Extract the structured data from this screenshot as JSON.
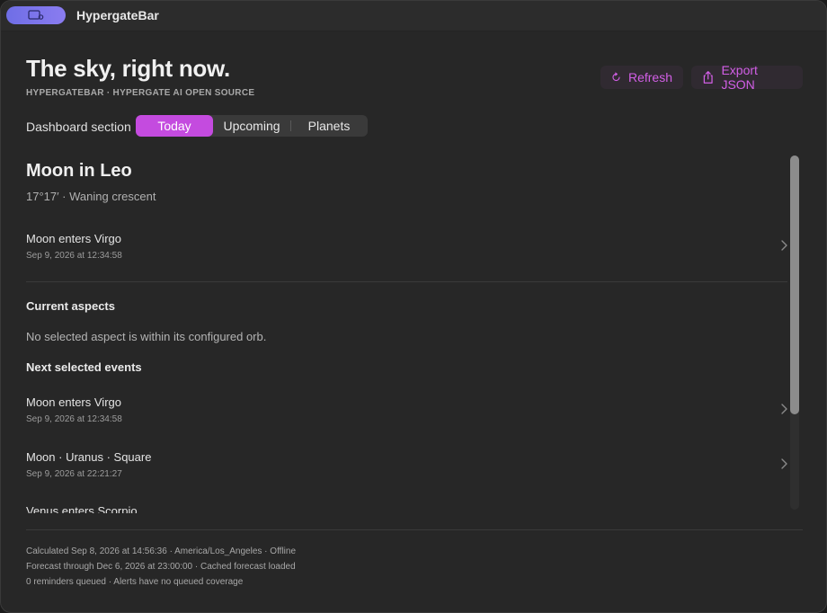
{
  "window": {
    "title": "HypergateBar"
  },
  "header": {
    "title": "The sky, right now.",
    "subtitle": "HYPERGATEBAR · HYPERGATE AI OPEN SOURCE",
    "refresh_label": "Refresh",
    "export_label": "Export JSON"
  },
  "section_picker": {
    "label": "Dashboard section",
    "tabs": [
      "Today",
      "Upcoming",
      "Planets"
    ],
    "selected": "Today"
  },
  "moon": {
    "title": "Moon in Leo",
    "detail": "17°17′ · Waning crescent",
    "next": {
      "title": "Moon enters Virgo",
      "date": "Sep 9, 2026 at 12:34:58"
    }
  },
  "aspects": {
    "heading": "Current aspects",
    "empty_text": "No selected aspect is within its configured orb."
  },
  "events": {
    "heading": "Next selected events",
    "items": [
      {
        "title": "Moon enters Virgo",
        "date": "Sep 9, 2026 at 12:34:58"
      },
      {
        "title": "Moon · Uranus · Square",
        "date": "Sep 9, 2026 at 22:21:27"
      },
      {
        "title": "Venus enters Scorpio",
        "date": ""
      }
    ]
  },
  "footer": {
    "line1": "Calculated Sep 8, 2026 at 14:56:36 · America/Los_Angeles · Offline",
    "line2": "Forecast through Dec 6, 2026 at 23:00:00 · Cached forecast loaded",
    "line3": "0 reminders queued · Alerts have no queued coverage"
  },
  "colors": {
    "accent": "#c44bdf",
    "accent_text": "#d25fe6",
    "background": "#272727"
  }
}
